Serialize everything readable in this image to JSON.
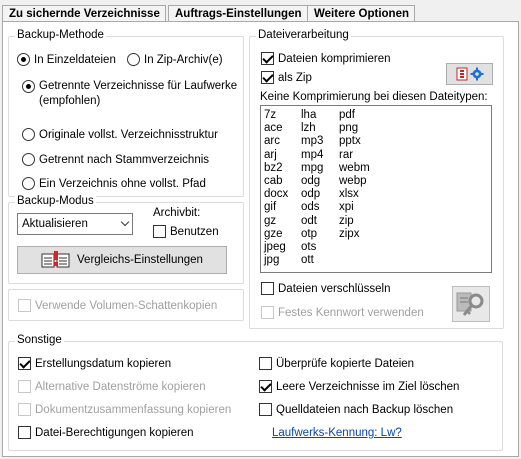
{
  "tabs": [
    "Zu sichernde Verzeichnisse",
    "Auftrags-Einstellungen",
    "Weitere Optionen"
  ],
  "backup_method": {
    "title": "Backup-Methode",
    "single_files": "In Einzeldateien",
    "zip_archive": "In Zip-Archiv(e)",
    "option1_line1": "Getrennte Verzeichnisse für Laufwerke",
    "option1_line2": "(empfohlen)",
    "option2": "Originale vollst. Verzeichnisstruktur",
    "option3": "Getrennt nach Stammverzeichnis",
    "option4": "Ein Verzeichnis ohne vollst. Pfad"
  },
  "backup_mode": {
    "title": "Backup-Modus",
    "selected": "Aktualisieren",
    "archive_bit_label": "Archivbit:",
    "use_label": "Benutzen",
    "compare_button": "Vergleichs-Einstellungen"
  },
  "shadow_copies": "Verwende Volumen-Schattenkopien",
  "file_processing": {
    "title": "Dateiverarbeitung",
    "compress": "Dateien komprimieren",
    "as_zip": "als Zip",
    "no_compress_label": "Keine Komprimierung bei diesen Dateitypen:",
    "filetypes_col1": [
      "7z",
      "ace",
      "arc",
      "arj",
      "bz2",
      "cab",
      "docx",
      "gif",
      "gz",
      "gze",
      "jpeg",
      "jpg"
    ],
    "filetypes_col2": [
      "lha",
      "lzh",
      "mp3",
      "mp4",
      "mpg",
      "odg",
      "odp",
      "ods",
      "odt",
      "otp",
      "ots",
      "ott"
    ],
    "filetypes_col3": [
      "pdf",
      "png",
      "pptx",
      "rar",
      "webm",
      "webp",
      "xlsx",
      "xpi",
      "zip",
      "zipx"
    ],
    "encrypt": "Dateien verschlüsseln",
    "fixed_password": "Festes Kennwort verwenden"
  },
  "misc": {
    "title": "Sonstige",
    "creation_date": "Erstellungsdatum kopieren",
    "alt_streams": "Alternative Datenströme kopieren",
    "doc_summary": "Dokumentzusammenfassung kopieren",
    "permissions": "Datei-Berechtigungen kopieren",
    "verify": "Überprüfe kopierte Dateien",
    "empty_dirs": "Leere Verzeichnisse im Ziel löschen",
    "delete_source": "Quelldateien nach Backup löschen",
    "drive_id_link": "Laufwerks-Kennung: Lw?"
  },
  "colors": {
    "link": "#0645ad",
    "gear_icon": "#1e6fd9",
    "disabled": "#a0a0a0"
  }
}
